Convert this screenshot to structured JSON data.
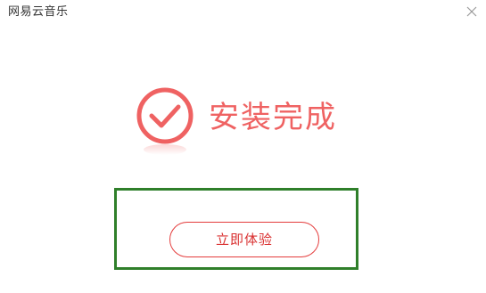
{
  "window": {
    "title": "网易云音乐"
  },
  "icons": {
    "close": "close-icon",
    "success": "check-circle-icon"
  },
  "main": {
    "status_text": "安装完成",
    "action_button_label": "立即体验"
  },
  "colors": {
    "accent": "#ef6262",
    "button_border": "#e43c3c",
    "highlight_border": "#2f7f2a"
  }
}
